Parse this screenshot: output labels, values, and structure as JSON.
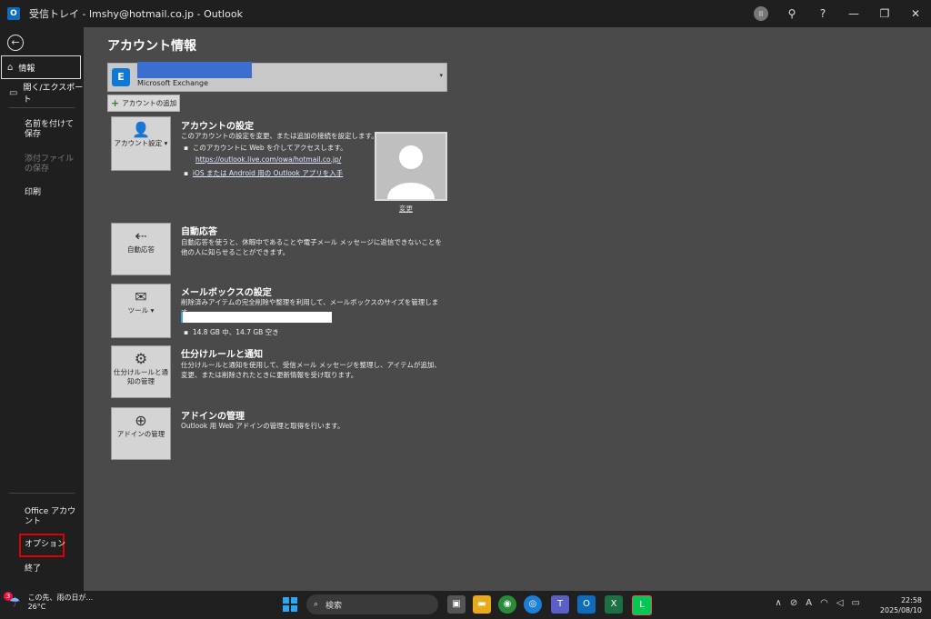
{
  "window": {
    "title": "受信トレイ - lmshy@hotmail.co.jp - Outlook",
    "avatar_initials": "ll",
    "controls": [
      "?",
      "—",
      "❐",
      "✕"
    ]
  },
  "sidebar": {
    "info": "情報",
    "open_export": "開く/エクスポート",
    "save_as": "名前を付けて保存",
    "save_attachments": "添付ファイルの保存",
    "print": "印刷",
    "office_account": "Office アカウント",
    "options": "オプション",
    "exit": "終了"
  },
  "main": {
    "title": "アカウント情報",
    "account_type": "Microsoft Exchange",
    "add_account": "アカウントの追加",
    "account_settings": {
      "tile_label": "アカウント設定",
      "title": "アカウントの設定",
      "desc": "このアカウントの設定を変更、または追加の接続を設定します。",
      "bullet1": "このアカウントに Web を介してアクセスします。",
      "url": "https://outlook.live.com/owa/hotmail.co.jp/",
      "bullet2": "iOS または Android 用の Outlook アプリを入手"
    },
    "change_photo": "変更",
    "auto_reply": {
      "tile_label": "自動応答",
      "title": "自動応答",
      "desc": "自動応答を使うと、休暇中であることや電子メール メッセージに返信できないことを他の人に知らせることができます。"
    },
    "mailbox": {
      "tile_label": "ツール",
      "title": "メールボックスの設定",
      "desc": "削除済みアイテムの完全削除や整理を利用して、メールボックスのサイズを管理します。",
      "usage": "14.8 GB 中、14.7 GB 空き",
      "used_fraction": 0.01
    },
    "rules": {
      "tile_label": "仕分けルールと通知の管理",
      "title": "仕分けルールと通知",
      "desc": "仕分けルールと通知を使用して、受信メール メッセージを整理し、アイテムが追加、変更、または削除されたときに更新情報を受け取ります。"
    },
    "addins": {
      "tile_label": "アドインの管理",
      "title": "アドインの管理",
      "desc": "Outlook 用 Web アドインの管理と取得を行います。"
    }
  },
  "taskbar": {
    "weather_badge": "3",
    "weather_line1": "この先、雨の日が...",
    "weather_line2": "26°C",
    "search": "検索",
    "time": "22:58",
    "date": "2025/08/10",
    "ime": "A"
  }
}
